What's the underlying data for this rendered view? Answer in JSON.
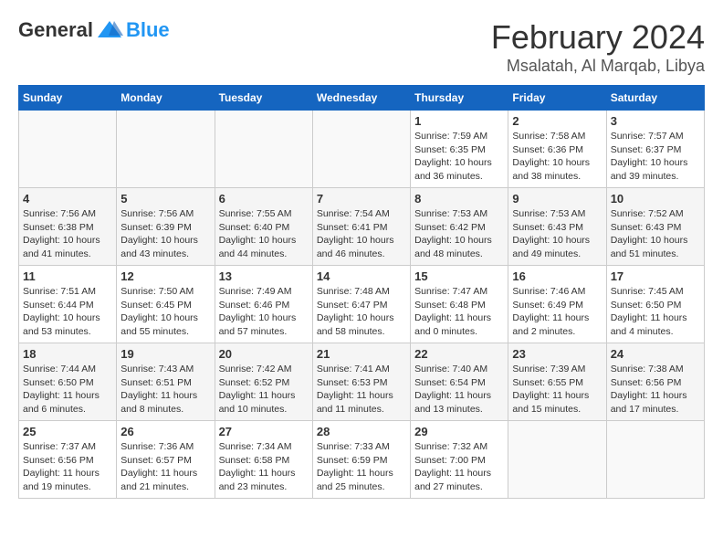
{
  "header": {
    "logo_general": "General",
    "logo_blue": "Blue",
    "title": "February 2024",
    "subtitle": "Msalatah, Al Marqab, Libya"
  },
  "weekdays": [
    "Sunday",
    "Monday",
    "Tuesday",
    "Wednesday",
    "Thursday",
    "Friday",
    "Saturday"
  ],
  "weeks": [
    [
      {
        "day": "",
        "info": ""
      },
      {
        "day": "",
        "info": ""
      },
      {
        "day": "",
        "info": ""
      },
      {
        "day": "",
        "info": ""
      },
      {
        "day": "1",
        "info": "Sunrise: 7:59 AM\nSunset: 6:35 PM\nDaylight: 10 hours\nand 36 minutes."
      },
      {
        "day": "2",
        "info": "Sunrise: 7:58 AM\nSunset: 6:36 PM\nDaylight: 10 hours\nand 38 minutes."
      },
      {
        "day": "3",
        "info": "Sunrise: 7:57 AM\nSunset: 6:37 PM\nDaylight: 10 hours\nand 39 minutes."
      }
    ],
    [
      {
        "day": "4",
        "info": "Sunrise: 7:56 AM\nSunset: 6:38 PM\nDaylight: 10 hours\nand 41 minutes."
      },
      {
        "day": "5",
        "info": "Sunrise: 7:56 AM\nSunset: 6:39 PM\nDaylight: 10 hours\nand 43 minutes."
      },
      {
        "day": "6",
        "info": "Sunrise: 7:55 AM\nSunset: 6:40 PM\nDaylight: 10 hours\nand 44 minutes."
      },
      {
        "day": "7",
        "info": "Sunrise: 7:54 AM\nSunset: 6:41 PM\nDaylight: 10 hours\nand 46 minutes."
      },
      {
        "day": "8",
        "info": "Sunrise: 7:53 AM\nSunset: 6:42 PM\nDaylight: 10 hours\nand 48 minutes."
      },
      {
        "day": "9",
        "info": "Sunrise: 7:53 AM\nSunset: 6:43 PM\nDaylight: 10 hours\nand 49 minutes."
      },
      {
        "day": "10",
        "info": "Sunrise: 7:52 AM\nSunset: 6:43 PM\nDaylight: 10 hours\nand 51 minutes."
      }
    ],
    [
      {
        "day": "11",
        "info": "Sunrise: 7:51 AM\nSunset: 6:44 PM\nDaylight: 10 hours\nand 53 minutes."
      },
      {
        "day": "12",
        "info": "Sunrise: 7:50 AM\nSunset: 6:45 PM\nDaylight: 10 hours\nand 55 minutes."
      },
      {
        "day": "13",
        "info": "Sunrise: 7:49 AM\nSunset: 6:46 PM\nDaylight: 10 hours\nand 57 minutes."
      },
      {
        "day": "14",
        "info": "Sunrise: 7:48 AM\nSunset: 6:47 PM\nDaylight: 10 hours\nand 58 minutes."
      },
      {
        "day": "15",
        "info": "Sunrise: 7:47 AM\nSunset: 6:48 PM\nDaylight: 11 hours\nand 0 minutes."
      },
      {
        "day": "16",
        "info": "Sunrise: 7:46 AM\nSunset: 6:49 PM\nDaylight: 11 hours\nand 2 minutes."
      },
      {
        "day": "17",
        "info": "Sunrise: 7:45 AM\nSunset: 6:50 PM\nDaylight: 11 hours\nand 4 minutes."
      }
    ],
    [
      {
        "day": "18",
        "info": "Sunrise: 7:44 AM\nSunset: 6:50 PM\nDaylight: 11 hours\nand 6 minutes."
      },
      {
        "day": "19",
        "info": "Sunrise: 7:43 AM\nSunset: 6:51 PM\nDaylight: 11 hours\nand 8 minutes."
      },
      {
        "day": "20",
        "info": "Sunrise: 7:42 AM\nSunset: 6:52 PM\nDaylight: 11 hours\nand 10 minutes."
      },
      {
        "day": "21",
        "info": "Sunrise: 7:41 AM\nSunset: 6:53 PM\nDaylight: 11 hours\nand 11 minutes."
      },
      {
        "day": "22",
        "info": "Sunrise: 7:40 AM\nSunset: 6:54 PM\nDaylight: 11 hours\nand 13 minutes."
      },
      {
        "day": "23",
        "info": "Sunrise: 7:39 AM\nSunset: 6:55 PM\nDaylight: 11 hours\nand 15 minutes."
      },
      {
        "day": "24",
        "info": "Sunrise: 7:38 AM\nSunset: 6:56 PM\nDaylight: 11 hours\nand 17 minutes."
      }
    ],
    [
      {
        "day": "25",
        "info": "Sunrise: 7:37 AM\nSunset: 6:56 PM\nDaylight: 11 hours\nand 19 minutes."
      },
      {
        "day": "26",
        "info": "Sunrise: 7:36 AM\nSunset: 6:57 PM\nDaylight: 11 hours\nand 21 minutes."
      },
      {
        "day": "27",
        "info": "Sunrise: 7:34 AM\nSunset: 6:58 PM\nDaylight: 11 hours\nand 23 minutes."
      },
      {
        "day": "28",
        "info": "Sunrise: 7:33 AM\nSunset: 6:59 PM\nDaylight: 11 hours\nand 25 minutes."
      },
      {
        "day": "29",
        "info": "Sunrise: 7:32 AM\nSunset: 7:00 PM\nDaylight: 11 hours\nand 27 minutes."
      },
      {
        "day": "",
        "info": ""
      },
      {
        "day": "",
        "info": ""
      }
    ]
  ]
}
